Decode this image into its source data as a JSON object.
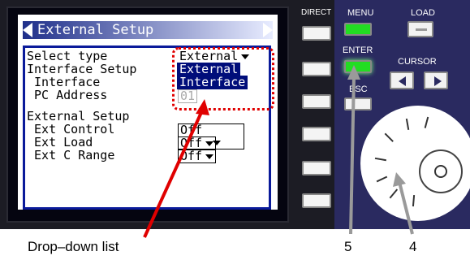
{
  "screen": {
    "title": "External Setup",
    "rows": [
      {
        "label": "Select type",
        "value": "External"
      },
      {
        "label": "Interface Setup",
        "value": "External"
      },
      {
        "label": " Interface",
        "value": "Interface"
      },
      {
        "label": " PC Address",
        "value": "01"
      },
      {
        "label": "External Setup"
      },
      {
        "label": " Ext Control",
        "value": "Off"
      },
      {
        "label": " Ext Load",
        "value": "Off"
      },
      {
        "label": " Ext C Range",
        "value": "Off"
      }
    ]
  },
  "buttons": {
    "direct": "DIRECT",
    "menu": "MENU",
    "load": "LOAD",
    "enter": "ENTER",
    "esc": "ESC",
    "cursor": "CURSOR"
  },
  "annotations": {
    "dropdown": "Drop–down list",
    "enter_ref": "5",
    "dial_ref": "4"
  },
  "colors": {
    "highlight": "#e00000",
    "selection": "#000d7a",
    "enter_led": "#22dd22"
  }
}
